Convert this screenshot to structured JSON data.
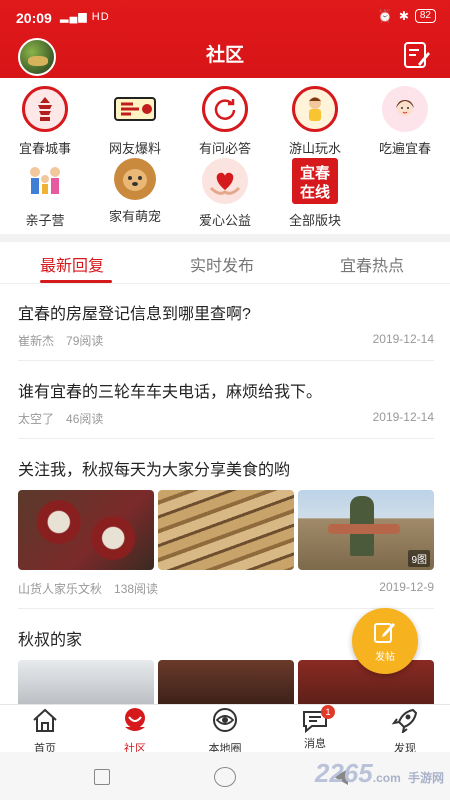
{
  "status": {
    "time": "20:09",
    "signal": "HD",
    "battery": "82"
  },
  "header": {
    "title": "社区"
  },
  "categories": [
    {
      "label": "宜春城事",
      "icon": "pagoda-icon"
    },
    {
      "label": "网友爆料",
      "icon": "megaphone-icon"
    },
    {
      "label": "有问必答",
      "icon": "refresh-icon"
    },
    {
      "label": "游山玩水",
      "icon": "traveler-icon"
    },
    {
      "label": "吃遍宜春",
      "icon": "girl-icon"
    },
    {
      "label": "亲子营",
      "icon": "family-icon"
    },
    {
      "label": "家有萌宠",
      "icon": "dog-icon"
    },
    {
      "label": "爱心公益",
      "icon": "heart-hands-icon"
    },
    {
      "label": "全部版块",
      "icon": "yichun-online-logo",
      "logo_text": "宜春在线"
    }
  ],
  "tabs": [
    "最新回复",
    "实时发布",
    "宜春热点"
  ],
  "posts": [
    {
      "title": "宜春的房屋登记信息到哪里查啊?",
      "author": "崔新杰",
      "views": "79阅读",
      "date": "2019-12-14"
    },
    {
      "title": "谁有宜春的三轮车车夫电话，麻烦给我下。",
      "author": "太空了",
      "views": "46阅读",
      "date": "2019-12-14"
    },
    {
      "title": "关注我，秋叔每天为大家分享美食的哟",
      "author": "山货人家乐文秋",
      "views": "138阅读",
      "date": "2019-12-9",
      "image_count": "9图"
    },
    {
      "title": "秋叔的家"
    }
  ],
  "fab": {
    "label": "发帖"
  },
  "nav": [
    {
      "label": "首页",
      "icon": "home-icon"
    },
    {
      "label": "社区",
      "icon": "community-icon"
    },
    {
      "label": "本地圈",
      "icon": "eye-icon"
    },
    {
      "label": "消息",
      "icon": "message-icon",
      "badge": "1"
    },
    {
      "label": "发现",
      "icon": "rocket-icon"
    }
  ],
  "watermark": {
    "brand": "2265",
    "suffix": ".com",
    "sub": "手游网"
  },
  "colors": {
    "primary": "#d6191c",
    "fab": "#f6b21f"
  }
}
